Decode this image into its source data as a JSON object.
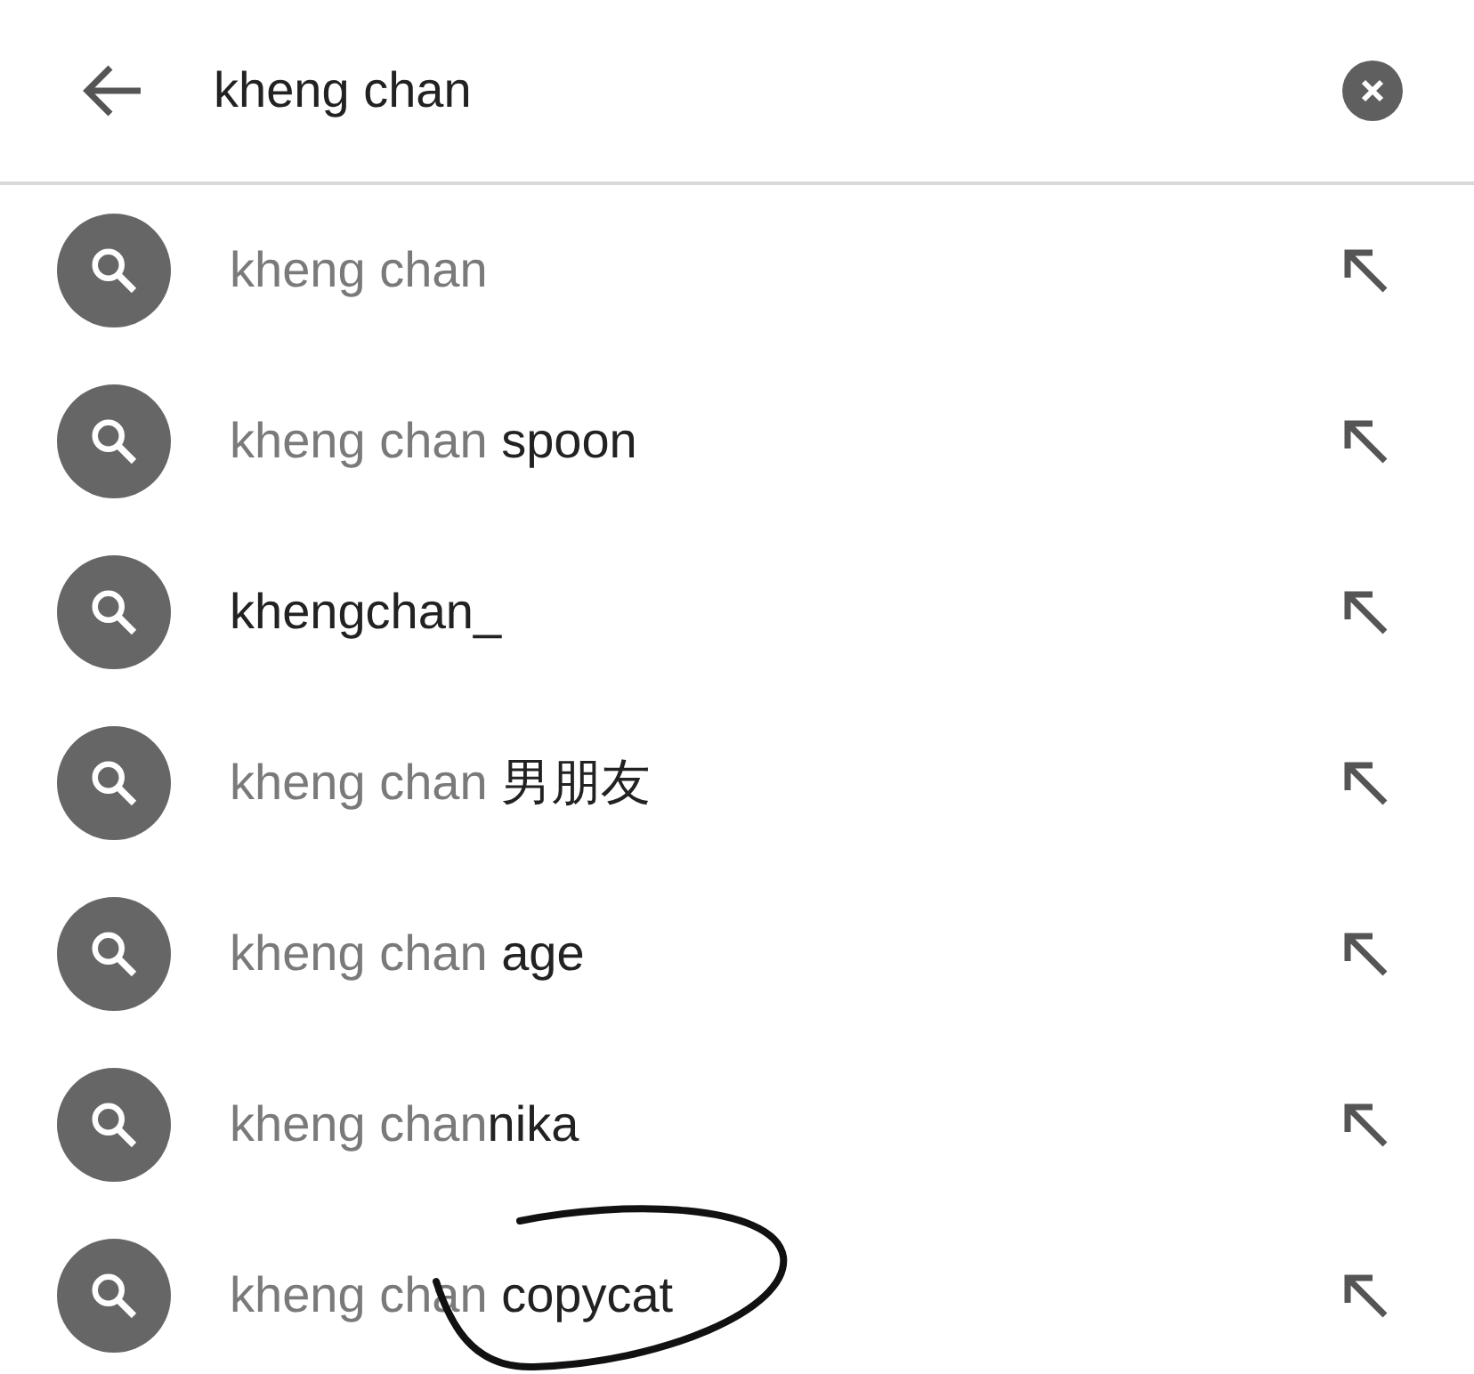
{
  "search": {
    "value": "kheng chan"
  },
  "suggestions": [
    {
      "prefix": "kheng chan"
    },
    {
      "prefix": "kheng chan",
      "suffix": " spoon"
    },
    {
      "suffix": "khengchan_"
    },
    {
      "prefix": "kheng chan",
      "suffix": " 男朋友"
    },
    {
      "prefix": "kheng chan",
      "suffix": " age"
    },
    {
      "prefix": "kheng chan",
      "suffix": "nika"
    },
    {
      "prefix": "kheng chan",
      "suffix": " copycat"
    }
  ]
}
